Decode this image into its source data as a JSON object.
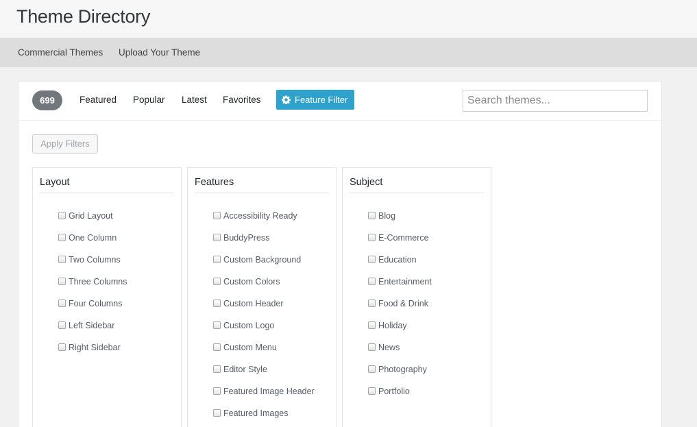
{
  "header": {
    "title": "Theme Directory"
  },
  "subnav": {
    "items": [
      "Commercial Themes",
      "Upload Your Theme"
    ]
  },
  "filter_bar": {
    "count": "699",
    "tabs": [
      "Featured",
      "Popular",
      "Latest",
      "Favorites"
    ],
    "feature_filter_label": "Feature Filter",
    "feature_filter_icon": "gear-icon",
    "search_placeholder": "Search themes...",
    "accent_color": "#2ea2cc"
  },
  "apply_filters_label": "Apply Filters",
  "groups": [
    {
      "title": "Layout",
      "options": [
        "Grid Layout",
        "One Column",
        "Two Columns",
        "Three Columns",
        "Four Columns",
        "Left Sidebar",
        "Right Sidebar"
      ]
    },
    {
      "title": "Features",
      "options": [
        "Accessibility Ready",
        "BuddyPress",
        "Custom Background",
        "Custom Colors",
        "Custom Header",
        "Custom Logo",
        "Custom Menu",
        "Editor Style",
        "Featured Image Header",
        "Featured Images"
      ]
    },
    {
      "title": "Subject",
      "options": [
        "Blog",
        "E-Commerce",
        "Education",
        "Entertainment",
        "Food & Drink",
        "Holiday",
        "News",
        "Photography",
        "Portfolio"
      ]
    }
  ]
}
